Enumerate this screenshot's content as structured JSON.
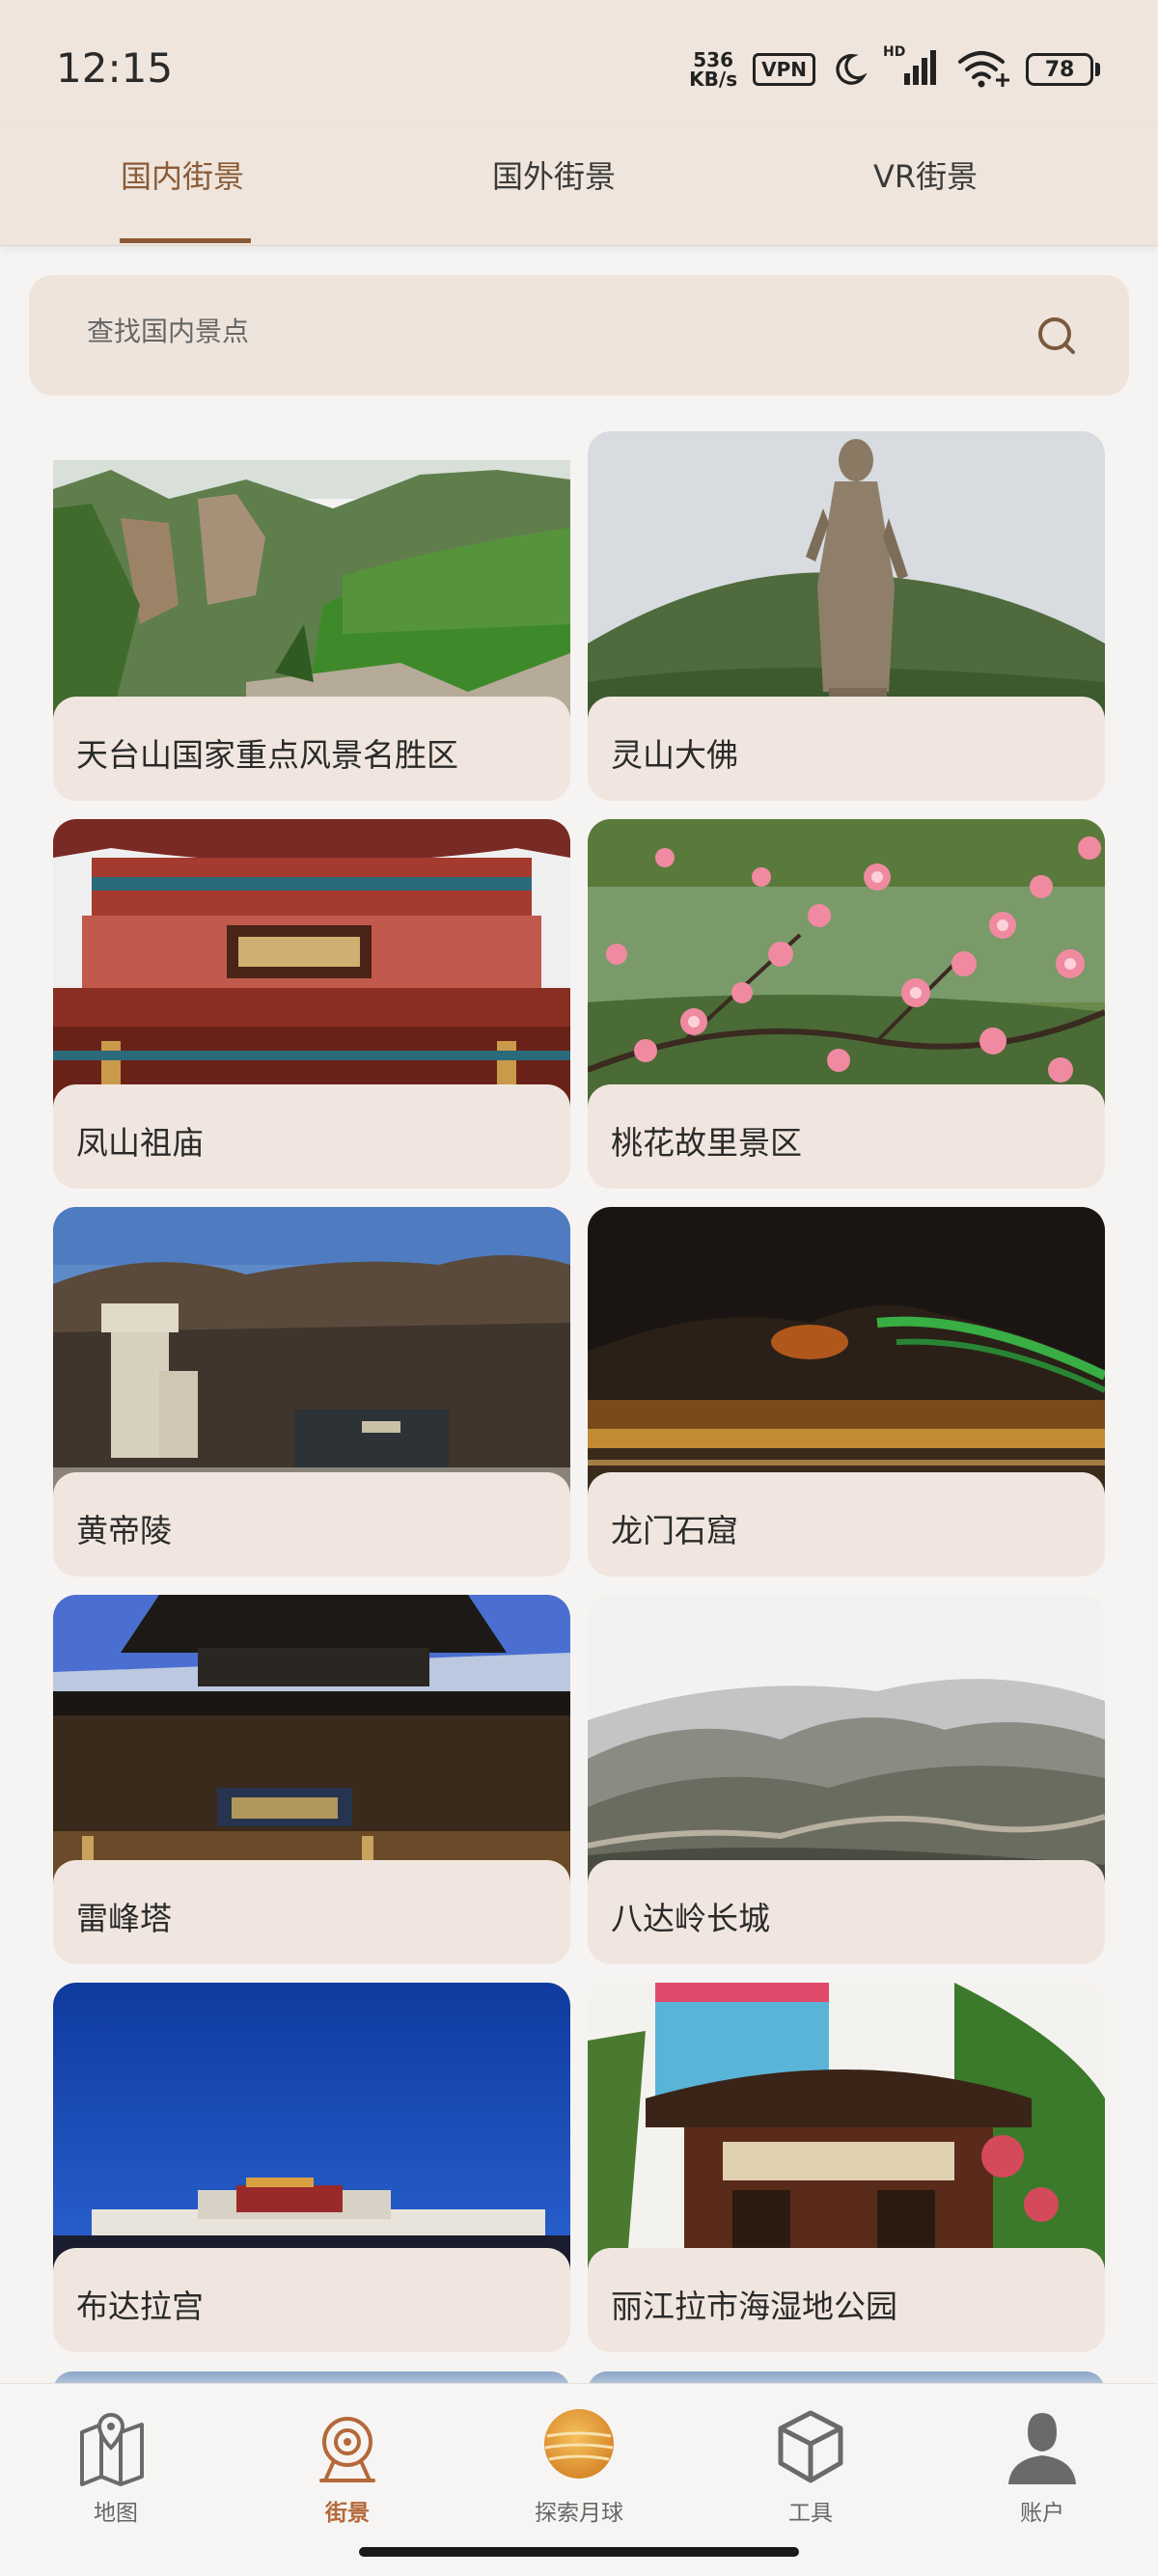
{
  "status_bar": {
    "time": "12:15",
    "net_speed_value": "536",
    "net_speed_unit": "KB/s",
    "vpn": "VPN",
    "signal_label": "HD",
    "battery": "78"
  },
  "tabs": [
    {
      "label": "国内街景",
      "active": true
    },
    {
      "label": "国外街景",
      "active": false
    },
    {
      "label": "VR街景",
      "active": false
    }
  ],
  "search": {
    "placeholder": "查找国内景点"
  },
  "places": [
    {
      "name": "天台山国家重点风景名胜区",
      "scene": "mountain-cliffs"
    },
    {
      "name": "灵山大佛",
      "scene": "buddha-statue"
    },
    {
      "name": "凤山祖庙",
      "scene": "temple-eaves"
    },
    {
      "name": "桃花故里景区",
      "scene": "peach-blossoms"
    },
    {
      "name": "黄帝陵",
      "scene": "mausoleum"
    },
    {
      "name": "龙门石窟",
      "scene": "night-lights"
    },
    {
      "name": "雷峰塔",
      "scene": "pagoda"
    },
    {
      "name": "八达岭长城",
      "scene": "great-wall"
    },
    {
      "name": "布达拉宫",
      "scene": "potala-palace"
    },
    {
      "name": "丽江拉市海湿地公园",
      "scene": "gate-building"
    }
  ],
  "bottom_nav": [
    {
      "label": "地图",
      "icon": "map-icon",
      "active": false
    },
    {
      "label": "街景",
      "icon": "street-view-icon",
      "active": true
    },
    {
      "label": "探索月球",
      "icon": "moon-globe-icon",
      "active": false
    },
    {
      "label": "工具",
      "icon": "cube-tools-icon",
      "active": false
    },
    {
      "label": "账户",
      "icon": "account-icon",
      "active": false
    }
  ],
  "colors": {
    "accent": "#8a5a36",
    "nav_active": "#b5683a",
    "header_bg": "#efe5dc",
    "card_label_bg": "#f0e6df"
  }
}
